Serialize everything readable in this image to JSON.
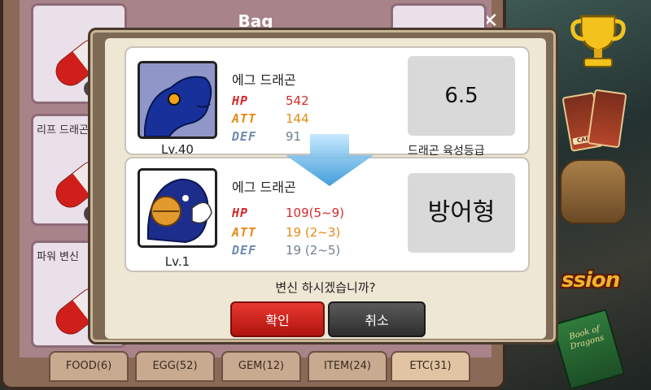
{
  "bag": {
    "title": "Bag",
    "close_label": "✕",
    "left_items": [
      {
        "name": ""
      },
      {
        "name": "리프 드래곤"
      },
      {
        "name": "파워 변신"
      }
    ],
    "tabs": [
      {
        "label": "FOOD(6)"
      },
      {
        "label": "EGG(52)"
      },
      {
        "label": "GEM(12)"
      },
      {
        "label": "ITEM(24)"
      },
      {
        "label": "ETC(31)"
      }
    ]
  },
  "side": {
    "card_label": "CARD",
    "mission_label": "ssion",
    "book_title": "Book of Dragons"
  },
  "dialog": {
    "before": {
      "name": "에그 드래곤",
      "level": "Lv.40",
      "stats": [
        {
          "key": "HP",
          "value": "542"
        },
        {
          "key": "ATT",
          "value": "144"
        },
        {
          "key": "DEF",
          "value": "91"
        }
      ],
      "badge": "6.5",
      "badge_caption": "드래곤 육성등급"
    },
    "after": {
      "name": "에그 드래곤",
      "level": "Lv.1",
      "stats": [
        {
          "key": "HP",
          "value": "109(5~9)"
        },
        {
          "key": "ATT",
          "value": "19 (2~3)"
        },
        {
          "key": "DEF",
          "value": "19 (2~5)"
        }
      ],
      "badge": "방어형"
    },
    "question": "변신 하시겠습니까?",
    "confirm_label": "확인",
    "cancel_label": "취소"
  },
  "colors": {
    "hp": "#d62a2a",
    "att": "#e58a14",
    "def": "#6f8bb2",
    "confirm": "#d0201a",
    "cancel": "#3a3a3a"
  },
  "icons": [
    "trophy-icon",
    "card-stack-icon",
    "backpack-icon",
    "book-icon",
    "down-arrow-icon",
    "close-icon",
    "potion-icon"
  ]
}
